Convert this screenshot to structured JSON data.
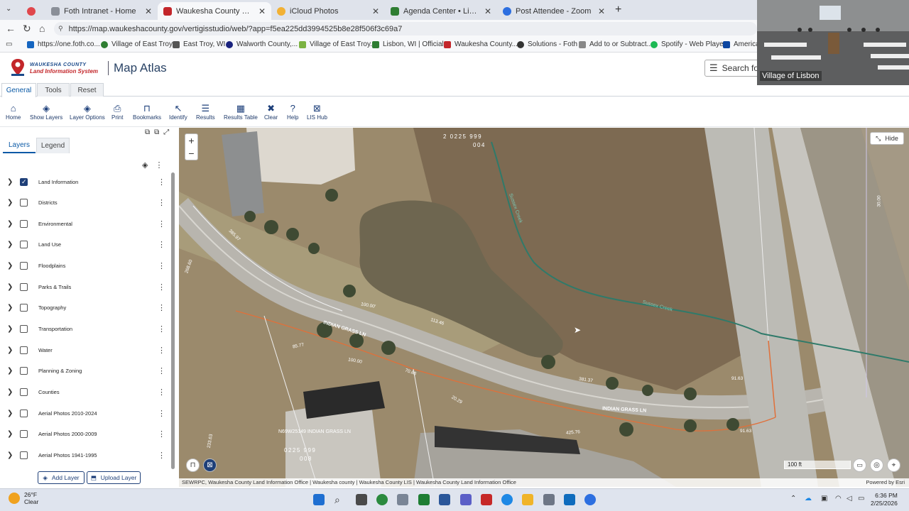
{
  "browser": {
    "tabs": [
      {
        "label": "",
        "color": "#e0474c"
      },
      {
        "label": "Foth Intranet - Home",
        "color": "#8a8f98"
      },
      {
        "label": "Waukesha County Map Atlas",
        "color": "#c3262a"
      },
      {
        "label": "iCloud Photos",
        "color": "#f2b134"
      },
      {
        "label": "Agenda Center • Lisbon, WI • Civic",
        "color": "#2e7d32"
      },
      {
        "label": "Post Attendee - Zoom",
        "color": "#2d6fe0"
      }
    ],
    "new_tab": "+",
    "url": "https://map.waukeshacounty.gov/vertigisstudio/web/?app=f5ea225dd3994525b8e28f506f3c69a7",
    "bookmarks": [
      {
        "label": "https://one.foth.co...",
        "color": "#1565c0"
      },
      {
        "label": "Village of East Troy...",
        "color": "#2e7d32"
      },
      {
        "label": "East Troy, WI",
        "color": "#555555"
      },
      {
        "label": "Walworth County,...",
        "color": "#1a237e"
      },
      {
        "label": "Village of East Troy...",
        "color": "#7cb342"
      },
      {
        "label": "Lisbon, WI | Official...",
        "color": "#2e7d32"
      },
      {
        "label": "Waukesha County...",
        "color": "#c3262a"
      },
      {
        "label": "Solutions - Foth",
        "color": "#333333"
      },
      {
        "label": "Add to or Subtract...",
        "color": "#888888"
      },
      {
        "label": "Spotify - Web Player",
        "color": "#1db954"
      },
      {
        "label": "American",
        "color": "#0d47a1"
      }
    ]
  },
  "app": {
    "logo_line1": "WAUKESHA COUNTY",
    "logo_line2": "Land Information System",
    "title": "Map Atlas",
    "search_placeholder": "Search for",
    "ribbon_tabs": [
      "General",
      "Tools",
      "Reset"
    ],
    "tools": [
      {
        "label": "Home",
        "icon": "home-icon",
        "glyph": "⌂"
      },
      {
        "label": "Show Layers",
        "icon": "layers-icon",
        "glyph": "◈"
      },
      {
        "label": "Layer Options",
        "icon": "layer-options-icon",
        "glyph": "◈"
      },
      {
        "label": "Print",
        "icon": "print-icon",
        "glyph": "⎙"
      },
      {
        "label": "Bookmarks",
        "icon": "bookmarks-icon",
        "glyph": "⊓"
      },
      {
        "label": "Identify",
        "icon": "identify-icon",
        "glyph": "↖"
      },
      {
        "label": "Results",
        "icon": "results-icon",
        "glyph": "☰"
      },
      {
        "label": "Results Table",
        "icon": "results-table-icon",
        "glyph": "▦"
      },
      {
        "label": "Clear",
        "icon": "clear-icon",
        "glyph": "✖"
      },
      {
        "label": "Help",
        "icon": "help-icon",
        "glyph": "?"
      },
      {
        "label": "LIS Hub",
        "icon": "lis-hub-icon",
        "glyph": "⊠"
      }
    ]
  },
  "panel": {
    "tabs": [
      "Layers",
      "Legend"
    ],
    "layers": [
      {
        "name": "Land Information",
        "checked": true
      },
      {
        "name": "Districts",
        "checked": false
      },
      {
        "name": "Environmental",
        "checked": false
      },
      {
        "name": "Land Use",
        "checked": false
      },
      {
        "name": "Floodplains",
        "checked": false
      },
      {
        "name": "Parks & Trails",
        "checked": false
      },
      {
        "name": "Topography",
        "checked": false
      },
      {
        "name": "Transportation",
        "checked": false
      },
      {
        "name": "Water",
        "checked": false
      },
      {
        "name": "Planning & Zoning",
        "checked": false
      },
      {
        "name": "Counties",
        "checked": false
      },
      {
        "name": "Aerial Photos 2010-2024",
        "checked": false
      },
      {
        "name": "Aerial Photos 2000-2009",
        "checked": false
      },
      {
        "name": "Aerial Photos 1941-1995",
        "checked": false
      }
    ],
    "add_layer": "Add Layer",
    "upload_layer": "Upload Layer"
  },
  "map": {
    "hide_label": "Hide",
    "zoom_in": "+",
    "zoom_out": "−",
    "labels": {
      "parcel_top": "2   0225 999",
      "parcel_top2": "004",
      "parcel_bottom": "0225 999",
      "parcel_bottom2": "008",
      "address": "N69W25149 INDIAN GRASS LN",
      "street1": "INDIAN GRASS LN",
      "street2": "INDIAN GRASS LN",
      "creek1": "Sussex Creek",
      "creek2": "Sussex Creek",
      "dim_385": "385.97",
      "dim_268": "268.60",
      "dim_100a": "100.00'",
      "dim_113": "113.46",
      "dim_85": "85.77",
      "dim_100b": "100.00",
      "dim_70": "70.68",
      "dim_20": "20.29",
      "dim_381": "381.37",
      "dim_91a": "91.63",
      "dim_425": "425.76",
      "dim_91b": "91.63",
      "dim_23": "233.63",
      "dim_30": "30.00"
    },
    "scale": "100 ft",
    "attribution": "SEWRPC, Waukesha County Land Information Office | Waukesha county | Waukesha County LIS | Waukesha County Land Information Office",
    "powered_by": "Powered by Esri"
  },
  "zoom": {
    "participant": "Village of Lisbon"
  },
  "taskbar": {
    "temp": "26°F",
    "condition": "Clear",
    "time": "6:36 PM",
    "date": "2/25/2026"
  },
  "colors": {
    "brand_blue": "#1e3f78",
    "accent_blue": "#0b5aa6",
    "parcel_line": "#e8e8e8",
    "lot_line": "#e0703a"
  }
}
